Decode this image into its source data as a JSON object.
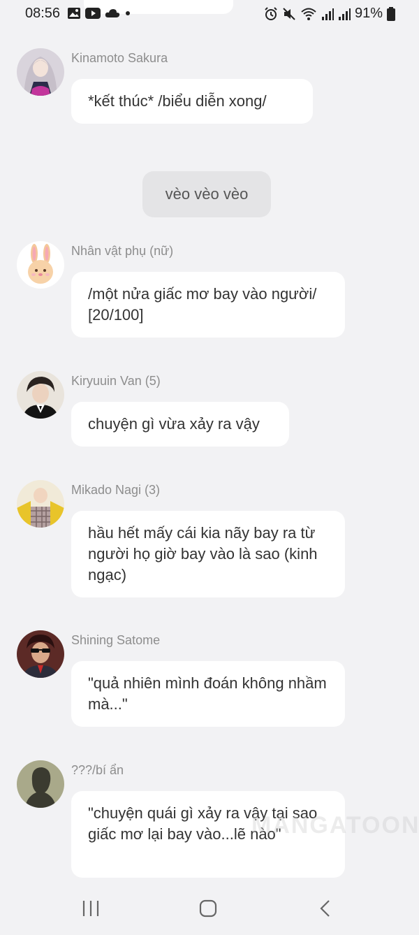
{
  "status_bar": {
    "time": "08:56",
    "battery": "91%",
    "icons_left": [
      "gallery-icon",
      "youtube-icon",
      "cloud-icon",
      "dot-icon"
    ],
    "icons_right": [
      "alarm-icon",
      "mute-icon",
      "wifi-icon",
      "signal-icon",
      "signal-icon",
      "battery-icon"
    ]
  },
  "messages": [
    {
      "sender": "Kinamoto Sakura",
      "text": "*kết thúc* /biểu diễn xong/",
      "avatar": "anime-girl-avatar"
    },
    {
      "system": "vèo vèo vèo"
    },
    {
      "sender": "Nhân vật phụ (nữ)",
      "text": "/một nửa giấc mơ bay vào người/ [20/100]",
      "avatar": "bunny-avatar"
    },
    {
      "sender": "Kiryuuin Van (5)",
      "text": "chuyện gì vừa xảy ra vậy",
      "avatar": "man-avatar"
    },
    {
      "sender": "Mikado Nagi (3)",
      "text": "hầu hết mấy cái kia nãy bay ra từ người họ giờ bay vào là sao (kinh ngạc)",
      "avatar": "blonde-avatar"
    },
    {
      "sender": "Shining Satome",
      "text": "\"quả nhiên mình đoán không nhầm mà...\"",
      "avatar": "sunglasses-avatar"
    },
    {
      "sender": "???/bí ẩn",
      "text": "\"chuyện quái gì xảy ra vậy tại sao giấc mơ lại bay vào...lẽ nào\"",
      "avatar": "silhouette-avatar"
    }
  ],
  "watermark": "MANGATOON",
  "nav": {
    "recent": "recent-apps-icon",
    "home": "home-icon",
    "back": "back-icon"
  }
}
